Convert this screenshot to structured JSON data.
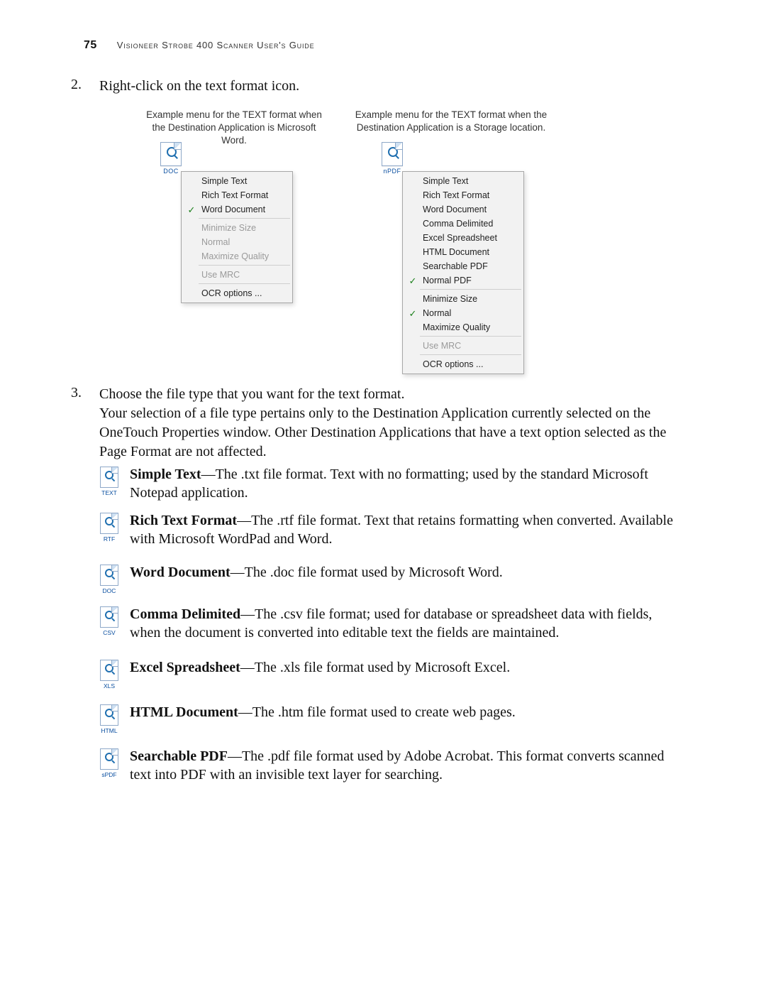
{
  "header": {
    "page_number": "75",
    "title": "Visioneer Strobe 400 Scanner User's Guide"
  },
  "steps": {
    "s2_num": "2.",
    "s2_text": "Right-click on the text format icon.",
    "s3_num": "3.",
    "s3_text": "Choose the file type that you want for the text format.",
    "s3_para": "Your selection of a file type pertains only to the Destination Application currently selected on the OneTouch Properties window. Other Destination Applications that have a text option selected as the Page Format are not affected."
  },
  "captions": {
    "left": "Example menu for the TEXT format when the Destination Application is Microsoft Word.",
    "right": "Example menu for the TEXT format when the Destination Application is a Storage location."
  },
  "icons": {
    "left_label": "DOC",
    "right_label": "nPDF"
  },
  "menu_left": {
    "groups": [
      [
        {
          "label": "Simple Text",
          "checked": false
        },
        {
          "label": "Rich Text Format",
          "checked": false
        },
        {
          "label": "Word Document",
          "checked": true
        }
      ],
      [
        {
          "label": "Minimize Size",
          "disabled": true
        },
        {
          "label": "Normal",
          "disabled": true
        },
        {
          "label": "Maximize Quality",
          "disabled": true
        }
      ],
      [
        {
          "label": "Use MRC",
          "disabled": true
        }
      ],
      [
        {
          "label": "OCR options ..."
        }
      ]
    ]
  },
  "menu_right": {
    "groups": [
      [
        {
          "label": "Simple Text"
        },
        {
          "label": "Rich Text Format"
        },
        {
          "label": "Word Document"
        },
        {
          "label": "Comma Delimited"
        },
        {
          "label": "Excel Spreadsheet"
        },
        {
          "label": "HTML Document"
        },
        {
          "label": "Searchable PDF"
        },
        {
          "label": "Normal PDF",
          "checked": true
        }
      ],
      [
        {
          "label": "Minimize Size"
        },
        {
          "label": "Normal",
          "checked": true
        },
        {
          "label": "Maximize Quality"
        }
      ],
      [
        {
          "label": "Use MRC",
          "disabled": true
        }
      ],
      [
        {
          "label": "OCR options ..."
        }
      ]
    ]
  },
  "definitions": [
    {
      "key": "TEXT",
      "bold": "Simple Text",
      "rest": "—The .txt file format. Text with no formatting; used by the standard Microsoft Notepad application."
    },
    {
      "key": "RTF",
      "bold": "Rich Text Format",
      "rest": "—The .rtf file format. Text that retains formatting when converted. Available with Microsoft WordPad and Word."
    },
    {
      "key": "DOC",
      "bold": "Word Document",
      "rest": "—The .doc file format used by Microsoft Word."
    },
    {
      "key": "CSV",
      "bold": "Comma Delimited",
      "rest": "—The .csv file format; used for database or spreadsheet data with fields, when the document is converted into editable text the fields are maintained."
    },
    {
      "key": "XLS",
      "bold": "Excel Spreadsheet",
      "rest": "—The .xls file format used by Microsoft Excel."
    },
    {
      "key": "HTML",
      "bold": "HTML Document",
      "rest": "—The .htm file format used to create web pages."
    },
    {
      "key": "sPDF",
      "bold": "Searchable PDF",
      "rest": "—The .pdf file format used by Adobe Acrobat. This format converts scanned text into PDF with an invisible text layer for searching."
    }
  ]
}
